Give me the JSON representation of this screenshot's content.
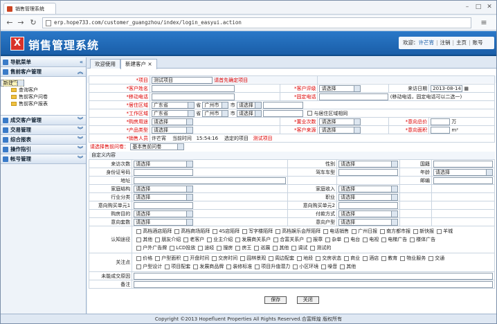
{
  "browser": {
    "tab_title": "销售管理系统",
    "url": "erp.hope733.com/customer_guangzhou/index/login_easyui.action"
  },
  "app": {
    "title": "销售管理系统",
    "logo": "X",
    "welcome": "欢迎：",
    "user": "许芒宵",
    "logout": "注销",
    "home": "主页",
    "account": "账号"
  },
  "sidebar": {
    "nav": "导航菜单",
    "groups": [
      {
        "label": "售前客户管理"
      },
      {
        "label": "成交客户管理"
      },
      {
        "label": "交易管理"
      },
      {
        "label": "综合报表"
      },
      {
        "label": "操作指引"
      },
      {
        "label": "帐号管理"
      }
    ],
    "items": [
      {
        "label": "新建客户"
      },
      {
        "label": "查询客户"
      },
      {
        "label": "售前客户问卷"
      },
      {
        "label": "售前客户报表"
      }
    ]
  },
  "tabs": [
    {
      "label": "欢迎使用"
    },
    {
      "label": "新建客户"
    }
  ],
  "form": {
    "required": "必填",
    "project_label": "*项目",
    "project_value": "测试项目",
    "project_hint": "请首先确定项目",
    "name_label": "*客户姓名",
    "rating_label": "*客户评级",
    "rating_value": "请选择",
    "visit_date_label": "来访日期",
    "visit_date_value": "2013-08-14",
    "mobile_label": "*移动电话",
    "phone_label": "*固定电话",
    "phone_hint": "(移动电话，固定电话可以二选一)",
    "home_area_label": "*居住区域",
    "work_area_label": "*工作区域",
    "province": "广东省",
    "city": "广州市",
    "district": "请选择",
    "sheng": "省",
    "shi": "市",
    "same_area": "与居住区域相同",
    "purpose_label": "*购房用途",
    "purpose_value": "请选择",
    "visits_label": "*置业次数",
    "visits_value": "请选择",
    "price_label": "*意向总价",
    "price_unit": "万",
    "product_label": "*产品类型",
    "product_value": "请选择",
    "source_label": "*客户来源",
    "source_value": "请选择",
    "area_label": "*意向面积",
    "area_unit": "m²",
    "sales_label": "*销售人员",
    "sales_value": "许芒宵",
    "time_label": "当前时间",
    "time_value": "15:54:16",
    "selected_label": "选定的项目",
    "selected_value": "测试项目",
    "survey_label": "请选择售前问卷：",
    "survey_value": "基本售前问卷",
    "custom": "自定义内容",
    "rows": [
      [
        "来访次数",
        "请选择",
        "性别",
        "请选择",
        "国籍",
        ""
      ],
      [
        "身份证号码",
        "",
        "驾车车型",
        "",
        "年龄",
        "请选择"
      ],
      [
        "地址",
        "",
        "",
        "",
        "邮编",
        ""
      ],
      [
        "家庭结构",
        "请选择",
        "家庭收入",
        "请选择",
        "",
        ""
      ],
      [
        "行业分类",
        "请选择",
        "职业",
        "请选择",
        "",
        ""
      ],
      [
        "意向购买单元1",
        "",
        "意向购买单元2",
        "",
        "",
        ""
      ],
      [
        "购房目的",
        "请选择",
        "付款方式",
        "请选择",
        "",
        ""
      ],
      [
        "意向套数",
        "请选择",
        "意向户型",
        "请选择",
        "",
        ""
      ]
    ],
    "channel_label": "认知途径",
    "channel_opts1": [
      "高档酒店陌拜",
      "高档商场陌拜",
      "4S店陌拜",
      "写字楼陌拜",
      "高档娱乐会所陌拜",
      "电话销售",
      "广州日报",
      "南方都市报",
      "新快报",
      "羊城"
    ],
    "channel_opts2": [
      "其他",
      "朋友介绍",
      "老客户",
      "业主介绍",
      "发展商关系户",
      "合富关系户",
      "报章",
      "杂单",
      "电台",
      "电视",
      "电梯广告",
      "楼体广告"
    ],
    "channel_opts3": [
      "户外广告牌",
      "LCD投放",
      "途经",
      "搜房",
      "房王",
      "巡展",
      "其他",
      "调试",
      "测试的"
    ],
    "focus_label": "关注点",
    "focus_opts1": [
      "价格",
      "户型面积",
      "开盘时间",
      "交房时间",
      "园林景观",
      "周边配套",
      "地段",
      "交房状态",
      "商业",
      "酒店",
      "教育",
      "物业服务",
      "交通"
    ],
    "focus_opts2": [
      "户型设计",
      "项目配套",
      "发展商品牌",
      "装修标准",
      "项目升值潜力",
      "小区环境",
      "噪音",
      "其他"
    ],
    "reason_label": "未能成交原因",
    "note_label": "备注"
  },
  "buttons": {
    "save": "保存",
    "close": "关闭"
  },
  "footer": "Copyright ©2013 Hopefluent Properties All Rights Reserved.合富辉煌 版权所有"
}
